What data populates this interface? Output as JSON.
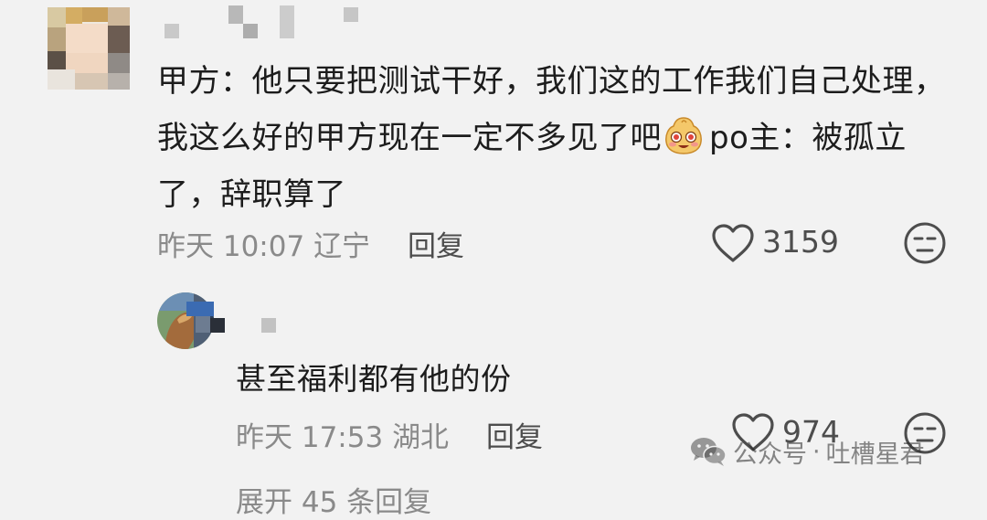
{
  "comments": [
    {
      "text_part1": "甲方：他只要把测试干好，我们这的工作我们自己处理，我这么好的甲方现在一定不多见了吧",
      "emoji": "smiling-dog-face-emoji",
      "text_part2": "po主：被孤立了，辞职算了",
      "time": "昨天 10:07",
      "location": "辽宁",
      "reply_label": "回复",
      "likes": "3159"
    },
    {
      "text": "甚至福利都有他的份",
      "time": "昨天 17:53",
      "location": "湖北",
      "reply_label": "回复",
      "likes": "974"
    }
  ],
  "expand_replies": "展开 45 条回复",
  "watermark": {
    "icon": "wechat-icon",
    "source": "公众号",
    "separator": "·",
    "account": "吐槽星君"
  }
}
